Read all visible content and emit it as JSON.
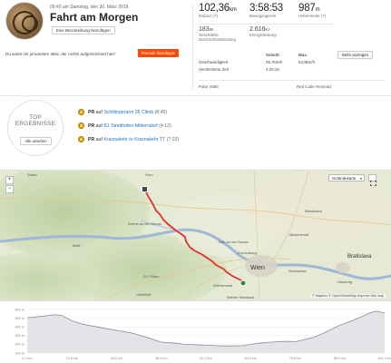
{
  "header": {
    "date": "09:43 am Samstag, den 30. März 2019",
    "title": "Fahrt am Morgen",
    "add_description": "Eine Beschreibung hinzufügen",
    "notice": "Du warst mit jemandem aktiv, der nichts aufgezeichnet hat?",
    "add_friends": "Freunde hinzufügen"
  },
  "stats": {
    "distance": {
      "value": "102,36",
      "unit": "km",
      "label": "Distanz (?)"
    },
    "moving_time": {
      "value": "3:58:53",
      "label": "Bewegungszeit"
    },
    "elevation": {
      "value": "987",
      "unit": "m",
      "label": "Höhenmeter (?)"
    },
    "avg_power": {
      "value": "183",
      "unit": "W",
      "label": "Geschätzte Durchschnittsleistung"
    },
    "energy": {
      "value": "2.616",
      "unit": "kJ",
      "label": "Energieleistung"
    }
  },
  "table": {
    "col_avg": "Schnitt",
    "col_max": "Max.",
    "speed_label": "Geschwindigkeit",
    "speed_avg": "25,7km/h",
    "speed_max": "54,9km/h",
    "elapsed_label": "Verstrichene Zeit",
    "elapsed_value": "4:20:19",
    "more_button": "Mehr anzeigen"
  },
  "devices": {
    "device": "Polar V650",
    "bike": "Red Cube Rennrad"
  },
  "achievements": {
    "badge_title": "TOP ERGEBNISSE",
    "show_all": "Alle ansehen",
    "prs": [
      {
        "prefix": "PR",
        "mid": " auf ",
        "segment": "Schiltingeramt 26 Climb",
        "time": "(8:45)"
      },
      {
        "prefix": "PR",
        "mid": " auf ",
        "segment": "B1 Streithofen-Mitterndorf",
        "time": "(4:12)"
      },
      {
        "prefix": "PR",
        "mid": " auf ",
        "segment": "Kraxnakehr to Kraxnakehr TT",
        "time": "(7:22)"
      }
    ]
  },
  "map": {
    "zoom_in": "+",
    "zoom_out": "−",
    "layer_select": "Geländekarte",
    "attribution": "© Mapbox © OpenStreetMap Improve this map",
    "labels": [
      {
        "text": "Zwettl"
      },
      {
        "text": "Horn"
      },
      {
        "text": "Krems an der Donau"
      },
      {
        "text": "Tulln an der Donau"
      },
      {
        "text": "Wien"
      },
      {
        "text": "Bratislava"
      },
      {
        "text": "St. Pölten"
      },
      {
        "text": "Wienerwald"
      },
      {
        "text": "Gänserndorf"
      },
      {
        "text": "Korneuburg"
      },
      {
        "text": "Mistelbach"
      },
      {
        "text": "Melk"
      },
      {
        "text": "Lilienfeld"
      },
      {
        "text": "Wiener Neustadt"
      },
      {
        "text": "Schwechat"
      },
      {
        "text": "Hainburg"
      }
    ],
    "route_color": "#e4312b",
    "start_color": "#2f8a2f"
  },
  "chart_data": {
    "type": "area",
    "y_ticks": [
      "600 m",
      "500 m",
      "400 m",
      "300 m",
      "200 m",
      "100 m"
    ],
    "x_ticks": [
      "0,0 km",
      "12,8 km",
      "25,6 km",
      "38,4 km",
      "51,2 km",
      "64,0 km",
      "76,8 km",
      "89,6 km",
      "102,4 km"
    ],
    "ylim": [
      100,
      600
    ],
    "xlim": [
      0,
      102.4
    ],
    "x": [
      0,
      4,
      8,
      10,
      12.8,
      16,
      20,
      25.6,
      30,
      35,
      38.4,
      42,
      45,
      48,
      51.2,
      54,
      58,
      62,
      64,
      67,
      70,
      74,
      76.8,
      79,
      82,
      85,
      89.6,
      93,
      96,
      98,
      100,
      102.4
    ],
    "y": [
      505,
      520,
      540,
      530,
      470,
      430,
      400,
      360,
      330,
      270,
      225,
      215,
      200,
      195,
      190,
      185,
      180,
      185,
      200,
      215,
      225,
      235,
      230,
      250,
      280,
      330,
      420,
      470,
      520,
      560,
      580,
      560
    ],
    "fill_color": "#e3e3e8",
    "line_color": "#8c8c96"
  }
}
